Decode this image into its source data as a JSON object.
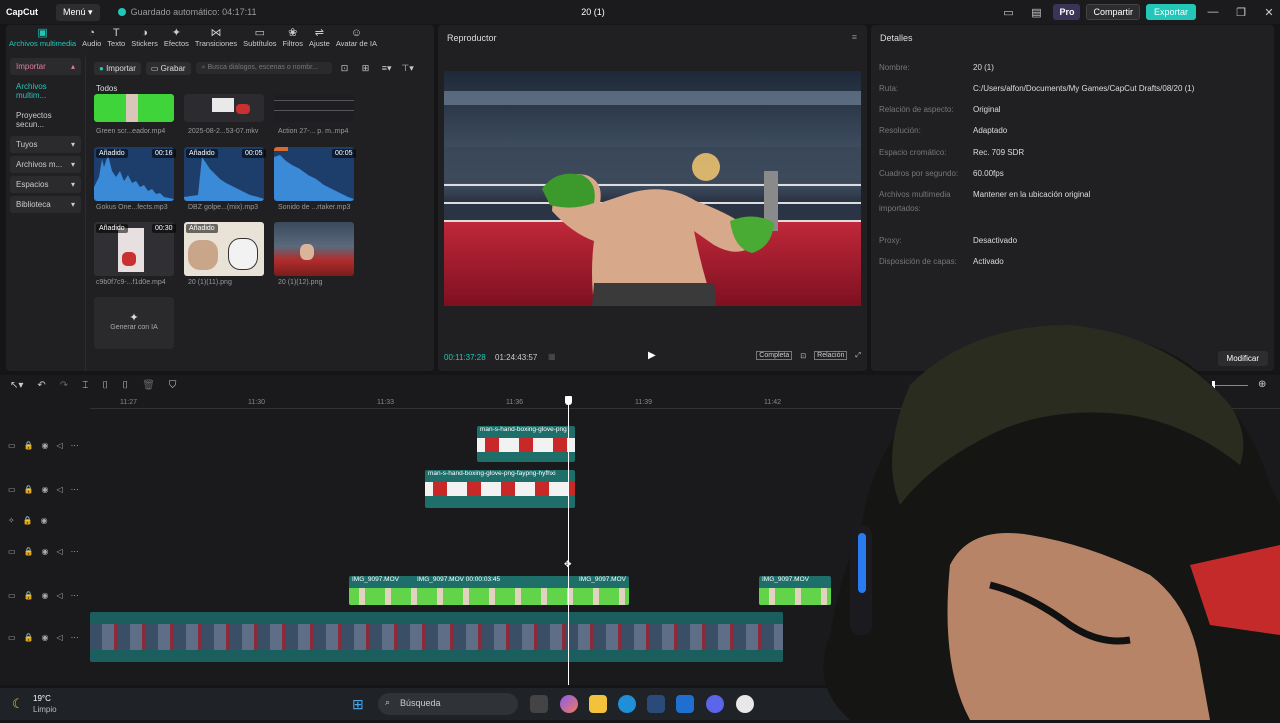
{
  "app": {
    "logo": "CapCut",
    "menu_label": "Menú",
    "autosave": "Guardado automático: 04:17:11",
    "project_title": "20 (1)",
    "pro": "Pro",
    "share": "Compartir",
    "export": "Exportar"
  },
  "tool_tabs": [
    {
      "label": "Archivos multimedia",
      "icon": "media-icon"
    },
    {
      "label": "Audio",
      "icon": "audio-icon"
    },
    {
      "label": "Texto",
      "icon": "text-icon"
    },
    {
      "label": "Stickers",
      "icon": "sticker-icon"
    },
    {
      "label": "Efectos",
      "icon": "effects-icon"
    },
    {
      "label": "Transiciones",
      "icon": "transitions-icon"
    },
    {
      "label": "Subtítulos",
      "icon": "subtitles-icon"
    },
    {
      "label": "Filtros",
      "icon": "filters-icon"
    },
    {
      "label": "Ajuste",
      "icon": "adjust-icon"
    },
    {
      "label": "Avatar de IA",
      "icon": "ai-avatar-icon"
    }
  ],
  "sidebar": [
    {
      "label": "Importar",
      "dropdown": true
    },
    {
      "label": "Archivos multim...",
      "dropdown": false
    },
    {
      "label": "Proyectos secun...",
      "dropdown": false
    },
    {
      "label": "Tuyos",
      "dropdown": true
    },
    {
      "label": "Archivos m...",
      "dropdown": true
    },
    {
      "label": "Espacios",
      "dropdown": true
    },
    {
      "label": "Biblioteca",
      "dropdown": true
    }
  ],
  "media_toolbar": {
    "import": "Importar",
    "record": "Grabar",
    "search_placeholder": "Busca diálogos, escenas o nombr..."
  },
  "media_section": "Todos",
  "media_items": [
    {
      "label": "Green scr...eador.mp4",
      "badge": "",
      "duration": ""
    },
    {
      "label": "2025-08-2...53-07.mkv",
      "badge": "",
      "duration": ""
    },
    {
      "label": "Action 27-... p. m..mp4",
      "badge": "",
      "duration": ""
    },
    {
      "label": "Gokus One...fects.mp3",
      "badge": "Añadido",
      "duration": "00:16"
    },
    {
      "label": "DBZ golpe...(mix).mp3",
      "badge": "Añadido",
      "duration": "00:05"
    },
    {
      "label": "Sonido de ...rtaker.mp3",
      "badge": "",
      "duration": "00:05"
    },
    {
      "label": "c9b0f7c9-...f1d0e.mp4",
      "badge": "Añadido",
      "duration": "00:30"
    },
    {
      "label": "20 (1)(11).png",
      "badge": "Añadido",
      "duration": ""
    },
    {
      "label": "20 (1)(12).png",
      "badge": "",
      "duration": ""
    }
  ],
  "generate_ai": "Generar con IA",
  "player": {
    "title": "Reproductor",
    "current_time": "00:11:37:28",
    "total_time": "01:24:43:57",
    "full": "Completa",
    "ratio": "Relación"
  },
  "details": {
    "title": "Detalles",
    "rows": [
      {
        "label": "Nombre:",
        "value": "20 (1)"
      },
      {
        "label": "Ruta:",
        "value": "C:/Users/alfon/Documents/My Games/CapCut Drafts/08/20 (1)"
      },
      {
        "label": "Relación de aspecto:",
        "value": "Original"
      },
      {
        "label": "Resolución:",
        "value": "Adaptado"
      },
      {
        "label": "Espacio cromático:",
        "value": "Rec. 709 SDR"
      },
      {
        "label": "Cuadros por segundo:",
        "value": "60.00fps"
      },
      {
        "label": "Archivos multimedia importados:",
        "value": "Mantener en la ubicación original"
      },
      {
        "label": "Proxy:",
        "value": "Desactivado"
      },
      {
        "label": "Disposición de capas:",
        "value": "Activado"
      }
    ],
    "modify": "Modificar"
  },
  "timeline": {
    "ticks": [
      "11:27",
      "11:30",
      "11:33",
      "11:36",
      "11:39",
      "11:42"
    ],
    "clips": {
      "glove1": "man-s-hand-boxing-glove-png",
      "glove2": "man-s-hand-boxing-glove-png-faypng-hyfhxi",
      "green1": "IMG_9097.MOV",
      "green2": "IMG_9097.MOV  00:00:03:45",
      "green3": "IMG_9097.MOV",
      "green4": "IMG_9097.MOV"
    }
  },
  "taskbar": {
    "temp": "19°C",
    "weather": "Limpio",
    "search": "Búsqueda"
  }
}
